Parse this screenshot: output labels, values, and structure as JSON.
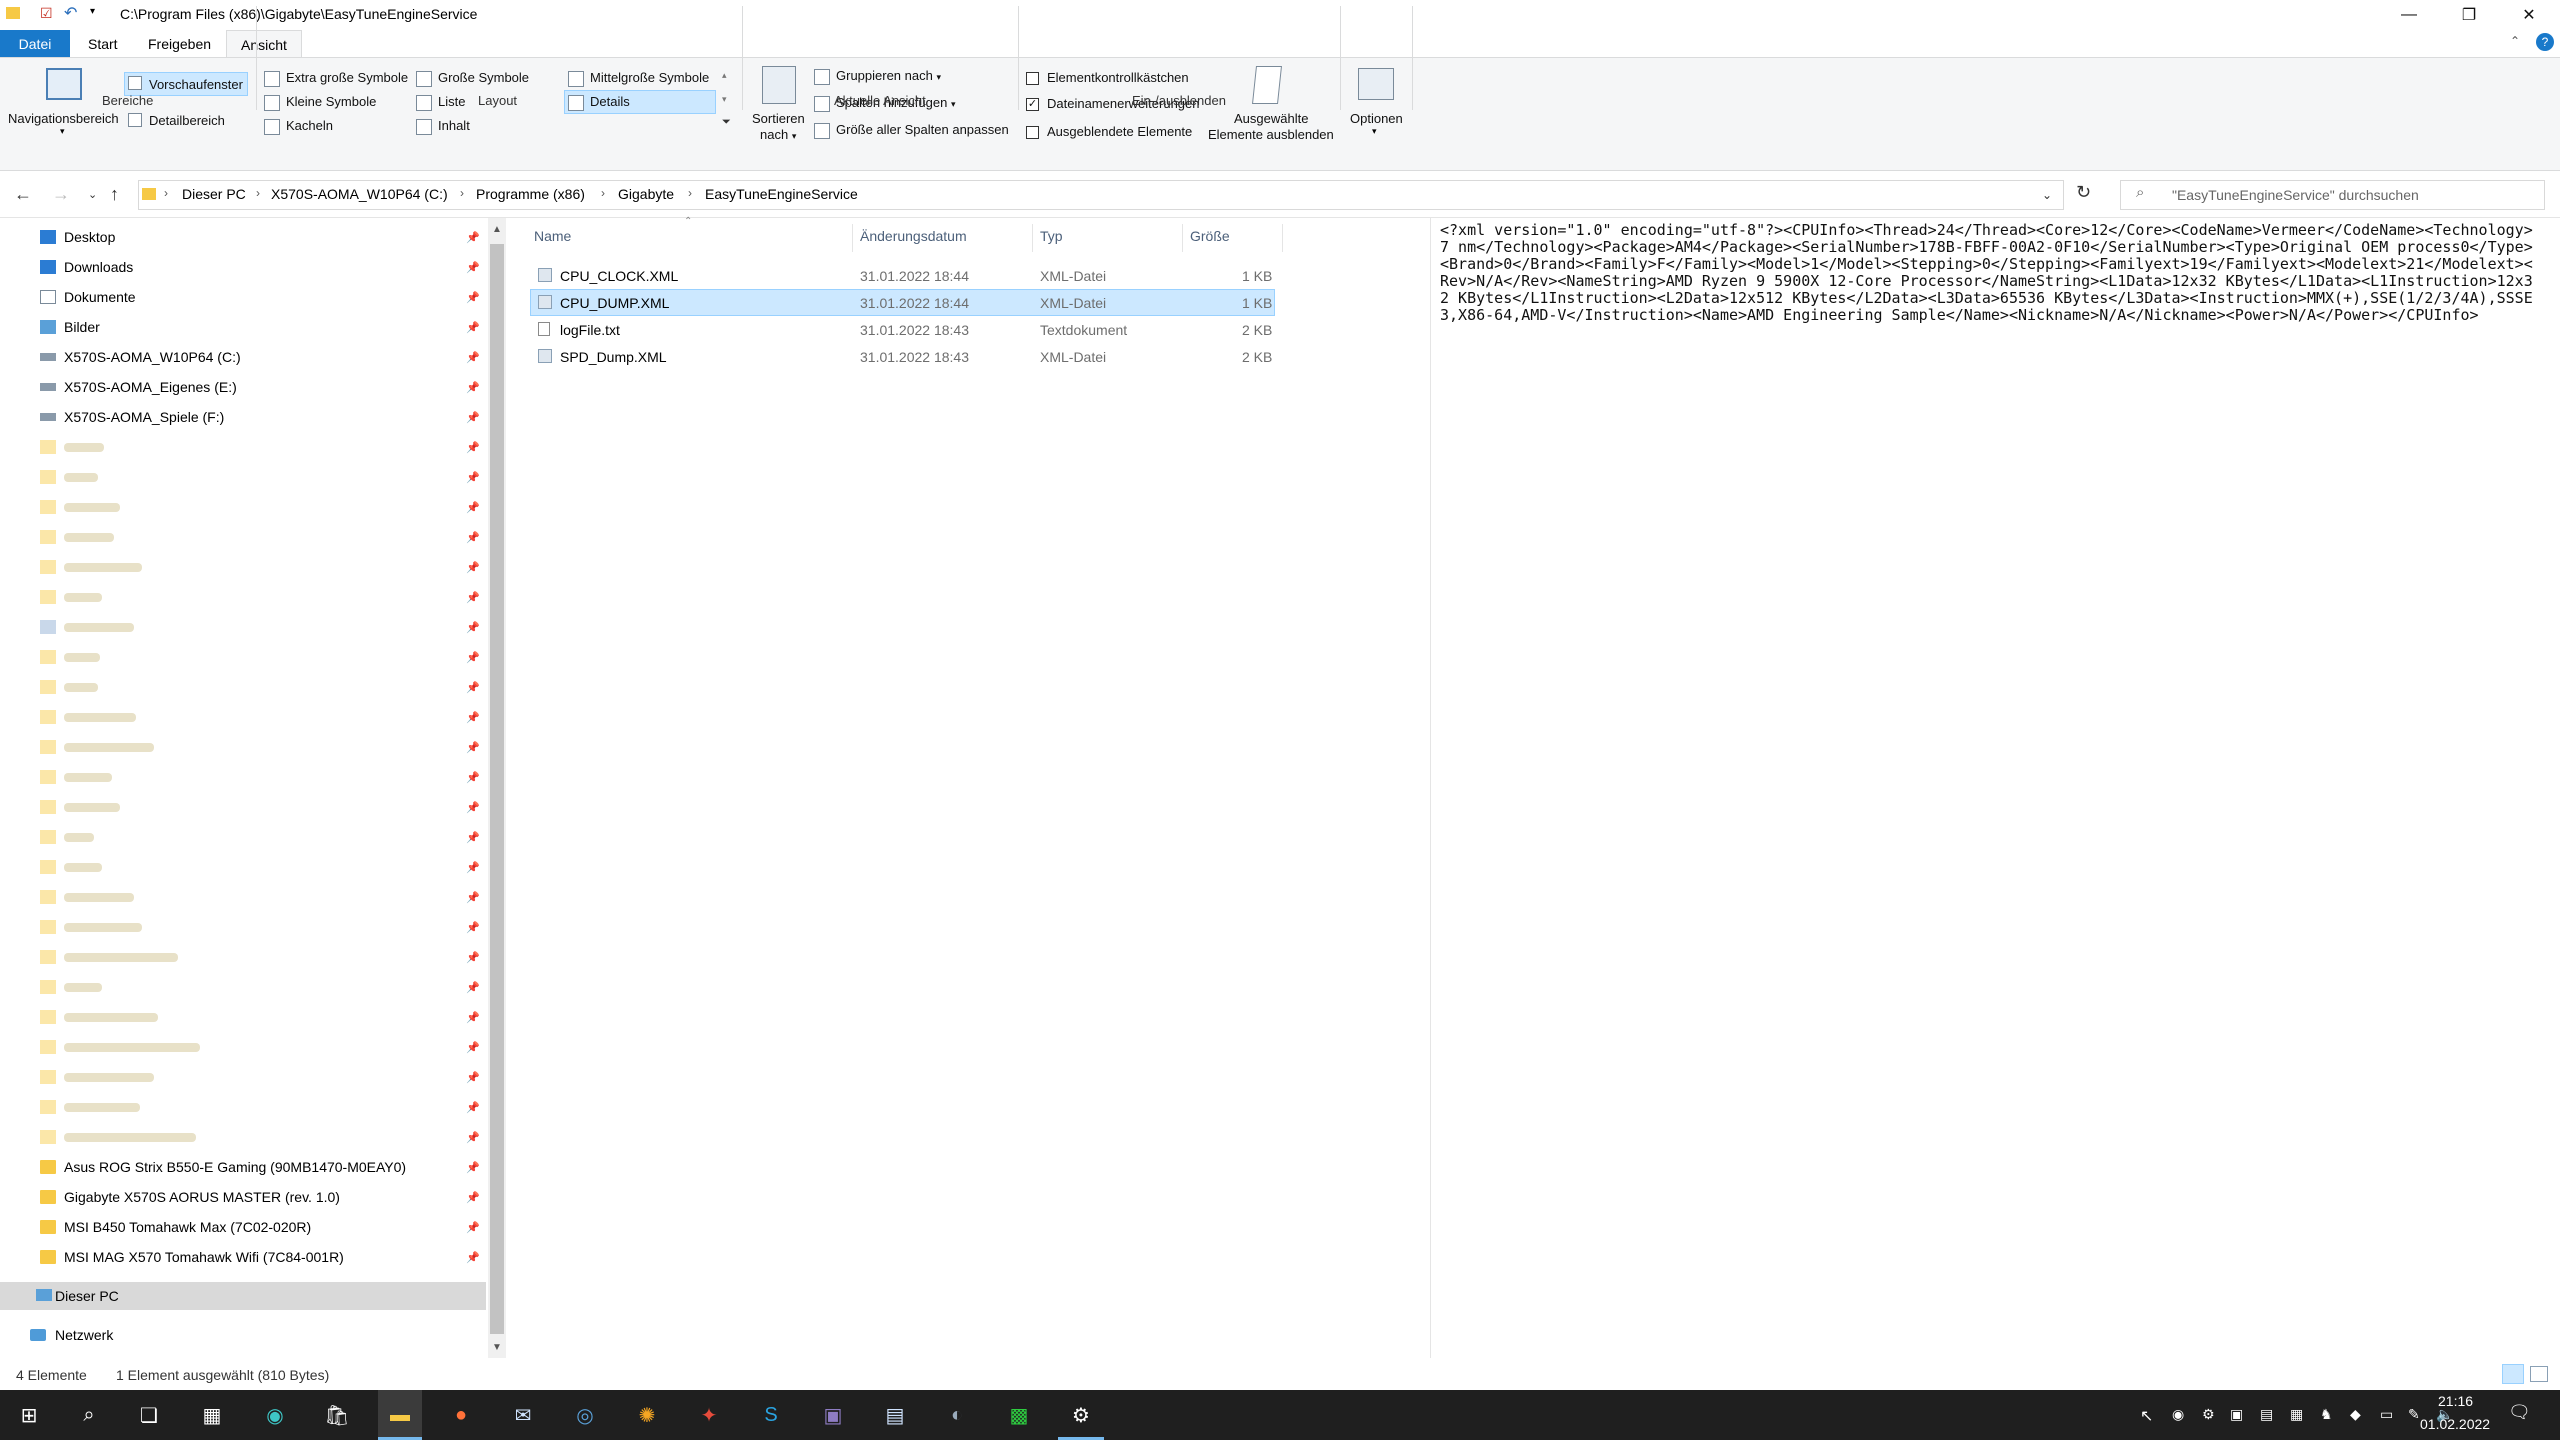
{
  "window": {
    "title": "C:\\Program Files (x86)\\Gigabyte\\EasyTuneEngineService"
  },
  "ribbon_tabs": [
    "Datei",
    "Start",
    "Freigeben",
    "Ansicht"
  ],
  "ribbon": {
    "bereiche": {
      "navigationsbereich": "Navigationsbereich",
      "vorschaufenster": "Vorschaufenster",
      "detailbereich": "Detailbereich",
      "label": "Bereiche"
    },
    "layout": {
      "items": [
        "Extra große Symbole",
        "Große Symbole",
        "Mittelgroße Symbole",
        "Kleine Symbole",
        "Liste",
        "Details",
        "Kacheln",
        "Inhalt"
      ],
      "label": "Layout"
    },
    "aktuelle_ansicht": {
      "sortieren_line1": "Sortieren",
      "sortieren_line2": "nach",
      "gruppieren": "Gruppieren nach",
      "spalten": "Spalten hinzufügen",
      "groesse": "Größe aller Spalten anpassen",
      "label": "Aktuelle Ansicht"
    },
    "ein_ausblenden": {
      "elementkontroll": "Elementkontrollkästchen",
      "dateinamen": "Dateinamenerweiterungen",
      "ausgeblendete": "Ausgeblendete Elemente",
      "ausgewaehlte_line1": "Ausgewählte",
      "ausgewaehlte_line2": "Elemente ausblenden",
      "label": "Ein-/ausblenden"
    },
    "optionen": "Optionen"
  },
  "address": {
    "crumbs": [
      "Dieser PC",
      "X570S-AOMA_W10P64 (C:)",
      "Programme (x86)",
      "Gigabyte",
      "EasyTuneEngineService"
    ],
    "search_placeholder": "\"EasyTuneEngineService\" durchsuchen"
  },
  "nav": {
    "quick": [
      "Desktop",
      "Downloads",
      "Dokumente",
      "Bilder",
      "X570S-AOMA_W10P64 (C:)",
      "X570S-AOMA_Eigenes (E:)",
      "X570S-AOMA_Spiele (F:)"
    ],
    "boards": [
      "Asus ROG Strix B550-E Gaming (90MB1470-M0EAY0)",
      "Gigabyte X570S AORUS MASTER (rev. 1.0)",
      "MSI B450 Tomahawk Max (7C02-020R)",
      "MSI MAG X570 Tomahawk Wifi (7C84-001R)"
    ],
    "this_pc": "Dieser PC",
    "network": "Netzwerk"
  },
  "files": {
    "headers": {
      "name": "Name",
      "date": "Änderungsdatum",
      "type": "Typ",
      "size": "Größe"
    },
    "rows": [
      {
        "name": "CPU_CLOCK.XML",
        "date": "31.01.2022 18:44",
        "type": "XML-Datei",
        "size": "1 KB"
      },
      {
        "name": "CPU_DUMP.XML",
        "date": "31.01.2022 18:44",
        "type": "XML-Datei",
        "size": "1 KB"
      },
      {
        "name": "logFile.txt",
        "date": "31.01.2022 18:43",
        "type": "Textdokument",
        "size": "2 KB"
      },
      {
        "name": "SPD_Dump.XML",
        "date": "31.01.2022 18:43",
        "type": "XML-Datei",
        "size": "2 KB"
      }
    ]
  },
  "preview": {
    "text": "<?xml version=\"1.0\" encoding=\"utf-8\"?><CPUInfo><Thread>24</Thread><Core>12</Core><CodeName>Vermeer</CodeName><Technology>7 nm</Technology><Package>AM4</Package><SerialNumber>178B-FBFF-00A2-0F10</SerialNumber><Type>Original OEM process0</Type><Brand>0</Brand><Family>F</Family><Model>1</Model><Stepping>0</Stepping><Familyext>19</Familyext><Modelext>21</Modelext><Rev>N/A</Rev><NameString>AMD Ryzen 9 5900X 12-Core Processor</NameString><L1Data>12x32 KBytes</L1Data><L1Instruction>12x32 KBytes</L1Instruction><L2Data>12x512 KBytes</L2Data><L3Data>65536 KBytes</L3Data><Instruction>MMX(+),SSE(1/2/3/4A),SSSE3,X86-64,AMD-V</Instruction><Name>AMD Engineering Sample</Name><Nickname>N/A</Nickname><Power>N/A</Power></CPUInfo>"
  },
  "status": {
    "count": "4 Elemente",
    "selection": "1 Element ausgewählt (810 Bytes)"
  },
  "taskbar": {
    "time": "21:16",
    "date": "01.02.2022"
  },
  "colors": {
    "accent": "#1979ca",
    "selection": "#cce8ff",
    "selection_border": "#99d1ff",
    "taskbar": "#1f1f1f"
  }
}
